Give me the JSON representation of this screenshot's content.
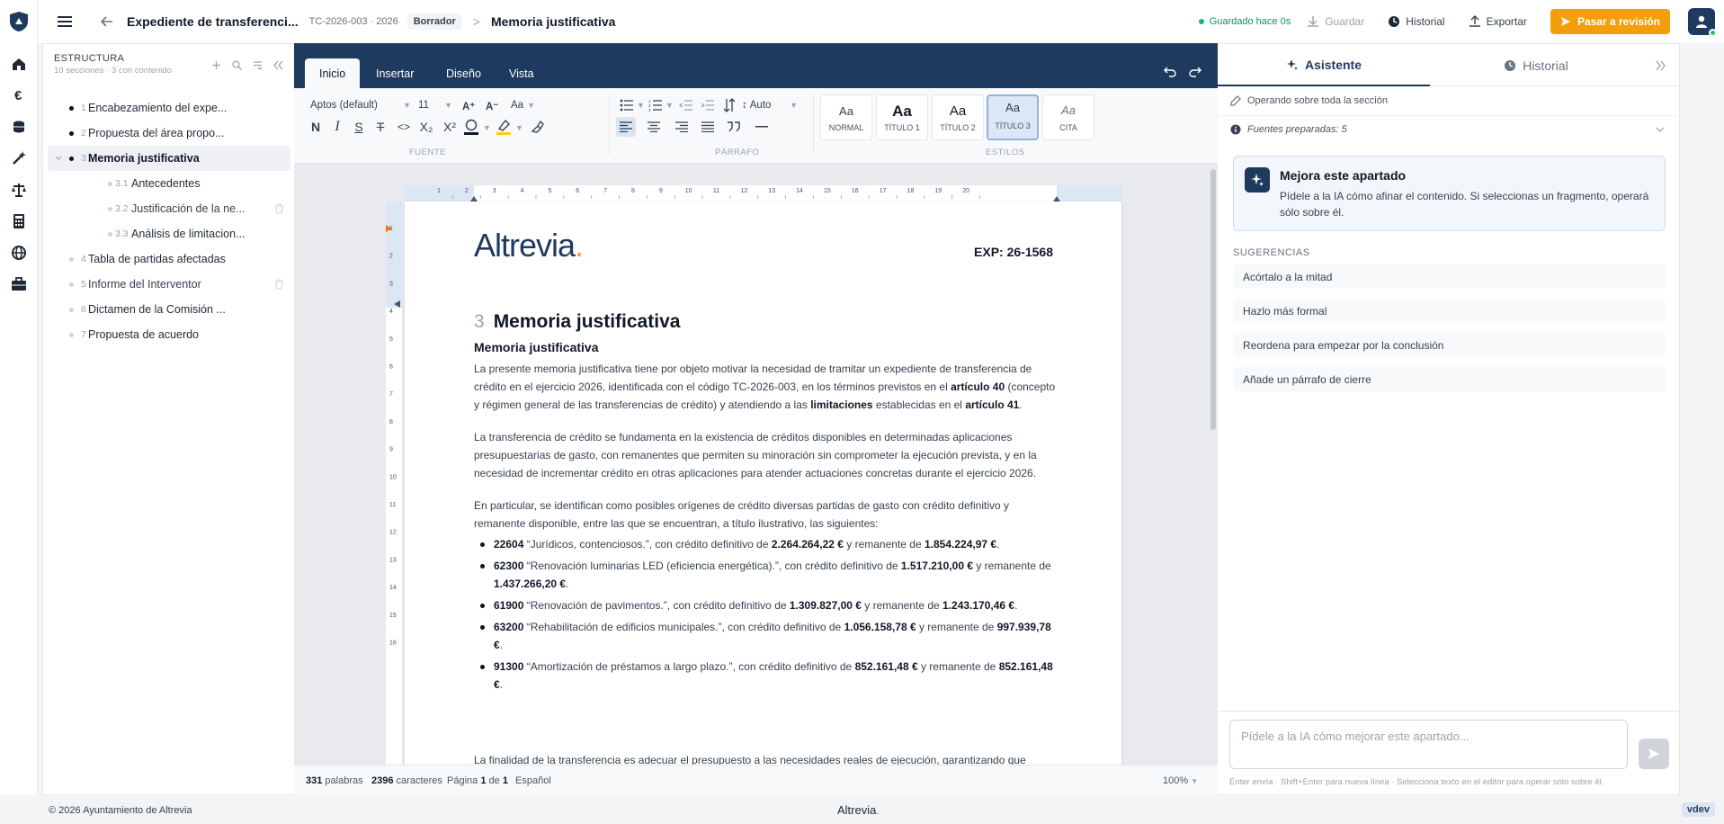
{
  "topbar": {
    "doc_title": "Expediente de transferenci...",
    "doc_code": "TC-2026-003 · 2026",
    "status_badge": "Borrador",
    "crumb_separator": ">",
    "current_section": "Memoria justificativa",
    "saved_status": "Guardado hace 0s",
    "save_label": "Guardar",
    "history_label": "Historial",
    "export_label": "Exportar",
    "submit_label": "Pasar a revisión"
  },
  "structure": {
    "title": "ESTRUCTURA",
    "subtitle": "10 secciones · 3 con contenido",
    "items": [
      {
        "num": "1",
        "label": "Encabezamiento del expe..."
      },
      {
        "num": "2",
        "label": "Propuesta del área propo..."
      },
      {
        "num": "3",
        "label": "Memoria justificativa"
      },
      {
        "num": "3.1",
        "label": "Antecedentes"
      },
      {
        "num": "3.2",
        "label": "Justificación de la ne..."
      },
      {
        "num": "3.3",
        "label": "Análisis de limitacion..."
      },
      {
        "num": "4",
        "label": "Tabla de partidas afectadas"
      },
      {
        "num": "5",
        "label": "Informe del Interventor"
      },
      {
        "num": "6",
        "label": "Dictamen de la Comisión ..."
      },
      {
        "num": "7",
        "label": "Propuesta de acuerdo"
      }
    ]
  },
  "ribbon": {
    "tabs": [
      "Inicio",
      "Insertar",
      "Diseño",
      "Vista"
    ],
    "font_family": "Aptos (default)",
    "font_size": "11",
    "grow_font": "A⁺",
    "shrink_font": "A⁻",
    "case_label": "Aa",
    "bold": "N",
    "italic": "I",
    "underline": "S",
    "strike": "T",
    "code": "<>",
    "subscript": "X₂",
    "superscript": "X²",
    "spacing_label": "Auto",
    "group_font": "FUENTE",
    "group_paragraph": "PÁRRAFO",
    "group_styles": "ESTILOS",
    "styles": [
      {
        "preview": "Aa",
        "name": "NORMAL"
      },
      {
        "preview": "Aa",
        "name": "TÍTULO 1"
      },
      {
        "preview": "Aa",
        "name": "TÍTULO 2"
      },
      {
        "preview": "Aa",
        "name": "TÍTULO 3"
      },
      {
        "preview": "Aa",
        "name": "CITA"
      }
    ]
  },
  "ruler": {
    "h_ticks": [
      "1",
      "2",
      "3",
      "4",
      "5",
      "6",
      "7",
      "8",
      "9",
      "10",
      "11",
      "12",
      "13",
      "14",
      "15",
      "16",
      "17",
      "18",
      "19",
      "20"
    ],
    "v_ticks": [
      "1",
      "2",
      "3",
      "4",
      "5",
      "6",
      "7",
      "8",
      "9",
      "10",
      "11",
      "12",
      "13",
      "14",
      "15",
      "16"
    ]
  },
  "document": {
    "brand": "Altrevia",
    "brand_dot": ".",
    "exp": "EXP: 26-1568",
    "heading_num": "3",
    "heading": "Memoria justificativa",
    "subheading": "Memoria justificativa",
    "p1_a": "La presente memoria justificativa tiene por objeto motivar la necesidad de tramitar un expediente de transferencia de crédito en el ejercicio 2026, identificada con el código TC-2026-003, en los términos previstos en el ",
    "p1_b1": "artículo 40",
    "p1_c": " (concepto y régimen general de las transferencias de crédito) y atendiendo a las ",
    "p1_b2": "limitaciones",
    "p1_d": " establecidas en el ",
    "p1_b3": "artículo 41",
    "p1_e": ".",
    "p2": "La transferencia de crédito se fundamenta en la existencia de créditos disponibles en determinadas aplicaciones presupuestarias de gasto, con remanentes que permiten su minoración sin comprometer la ejecución prevista, y en la necesidad de incrementar crédito en otras aplicaciones para atender actuaciones concretas durante el ejercicio 2026.",
    "p3": "En particular, se identifican como posibles orígenes de crédito diversas partidas de gasto con crédito definitivo y remanente disponible, entre las que se encuentran, a título ilustrativo, las siguientes:",
    "items": [
      {
        "code": "22604",
        "desc": " “Jurídicos, contenciosos.”, con crédito definitivo de ",
        "def": "2.264.264,22 €",
        "mid": " y remanente de ",
        "rem": "1.854.224,97 €",
        "end": "."
      },
      {
        "code": "62300",
        "desc": " “Renovación luminarias LED (eficiencia energética).”, con crédito definitivo de ",
        "def": "1.517.210,00 €",
        "mid": " y remanente de ",
        "rem": "1.437.266,20 €",
        "end": "."
      },
      {
        "code": "61900",
        "desc": " “Renovación de pavimentos.”, con crédito definitivo de ",
        "def": "1.309.827,00 €",
        "mid": " y remanente de ",
        "rem": "1.243.170,46 €",
        "end": "."
      },
      {
        "code": "63200",
        "desc": " “Rehabilitación de edificios municipales.”, con crédito definitivo de ",
        "def": "1.056.158,78 €",
        "mid": " y remanente de ",
        "rem": "997.939,78 €",
        "end": "."
      },
      {
        "code": "91300",
        "desc": " “Amortización de préstamos a largo plazo.”, con crédito definitivo de ",
        "def": "852.161,48 €",
        "mid": " y remanente de ",
        "rem": "852.161,48 €",
        "end": "."
      }
    ],
    "p4": "La finalidad de la transferencia es adecuar el presupuesto a las necesidades reales de ejecución, garantizando que"
  },
  "statusbar": {
    "words": "331",
    "words_label": "palabras",
    "chars": "2396",
    "chars_label": "caracteres",
    "page_label": "Página",
    "page_num": "1",
    "page_of": "de",
    "page_total": "1",
    "language": "Español",
    "zoom": "100%"
  },
  "assistant": {
    "tab_assistant": "Asistente",
    "tab_history": "Historial",
    "scope": "Operando sobre toda la sección",
    "sources": "Fuentes preparadas: 5",
    "card_title": "Mejora este apartado",
    "card_desc": "Pídele a la IA cómo afinar el contenido. Si seleccionas un fragmento, operará sólo sobre él.",
    "suggestions_label": "SUGERENCIAS",
    "suggestions": [
      "Acórtalo a la mitad",
      "Hazlo más formal",
      "Reordena para empezar por la conclusión",
      "Añade un párrafo de cierre"
    ],
    "input_placeholder": "Pídele a la IA cómo mejorar este apartado...",
    "hint": "Enter envía · Shift+Enter para nueva línea · Selecciona texto en el editor para operar sólo sobre él."
  },
  "footer": {
    "copyright": "© 2026 Ayuntamiento de Altrevia",
    "brand": "Altrevia",
    "brand_dot": ".",
    "env": "vdev"
  },
  "colors": {
    "navy": "#1e3a5f",
    "accent": "#f59e0b",
    "saved_green": "#059669"
  }
}
